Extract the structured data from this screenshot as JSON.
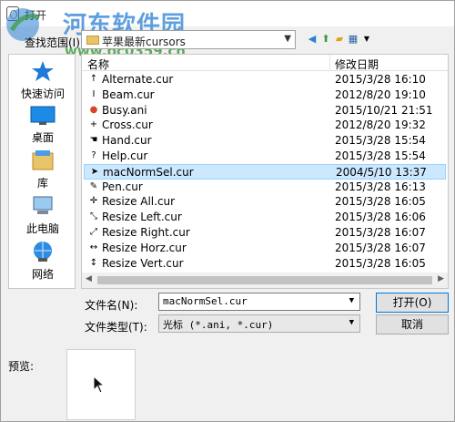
{
  "window": {
    "title": "打开"
  },
  "watermark": {
    "title": "河东软件园",
    "url": "www.pc0359.cn"
  },
  "lookin": {
    "label": "查找范围(I):",
    "value": "苹果最新cursors"
  },
  "places": [
    {
      "label": "快速访问",
      "icon": "star-icon"
    },
    {
      "label": "桌面",
      "icon": "desktop-icon"
    },
    {
      "label": "库",
      "icon": "library-icon"
    },
    {
      "label": "此电脑",
      "icon": "computer-icon"
    },
    {
      "label": "网络",
      "icon": "network-icon"
    }
  ],
  "filelist": {
    "columns": {
      "name": "名称",
      "date": "修改日期"
    },
    "rows": [
      {
        "name": "Alternate.cur",
        "date": "2015/3/28 16:10",
        "icon": "↑"
      },
      {
        "name": "Beam.cur",
        "date": "2012/8/20 19:10",
        "icon": "I"
      },
      {
        "name": "Busy.ani",
        "date": "2015/10/21 21:51",
        "icon": "●"
      },
      {
        "name": "Cross.cur",
        "date": "2012/8/20 19:32",
        "icon": "+"
      },
      {
        "name": "Hand.cur",
        "date": "2015/3/28 15:54",
        "icon": "☚"
      },
      {
        "name": "Help.cur",
        "date": "2015/3/28 15:54",
        "icon": "?"
      },
      {
        "name": "macNormSel.cur",
        "date": "2004/5/10 13:37",
        "icon": "➤"
      },
      {
        "name": "Pen.cur",
        "date": "2015/3/28 16:13",
        "icon": "✎"
      },
      {
        "name": "Resize All.cur",
        "date": "2015/3/28 16:05",
        "icon": "✛"
      },
      {
        "name": "Resize Left.cur",
        "date": "2015/3/28 16:06",
        "icon": "⤡"
      },
      {
        "name": "Resize Right.cur",
        "date": "2015/3/28 16:07",
        "icon": "⤢"
      },
      {
        "name": "Resize Horz.cur",
        "date": "2015/3/28 16:07",
        "icon": "↔"
      },
      {
        "name": "Resize Vert.cur",
        "date": "2015/3/28 16:05",
        "icon": "↕"
      }
    ],
    "selected_index": 6
  },
  "filename": {
    "label": "文件名(N):",
    "value": "macNormSel.cur"
  },
  "filetype": {
    "label": "文件类型(T):",
    "value": "光标 (*.ani, *.cur)"
  },
  "buttons": {
    "open": "打开(O)",
    "cancel": "取消"
  },
  "preview": {
    "label": "预览:"
  },
  "colors": {
    "selection": "#cce8ff",
    "accent": "#0078d7",
    "watermark_blue": "#2a7fd4",
    "watermark_green": "#3a9a3a"
  }
}
